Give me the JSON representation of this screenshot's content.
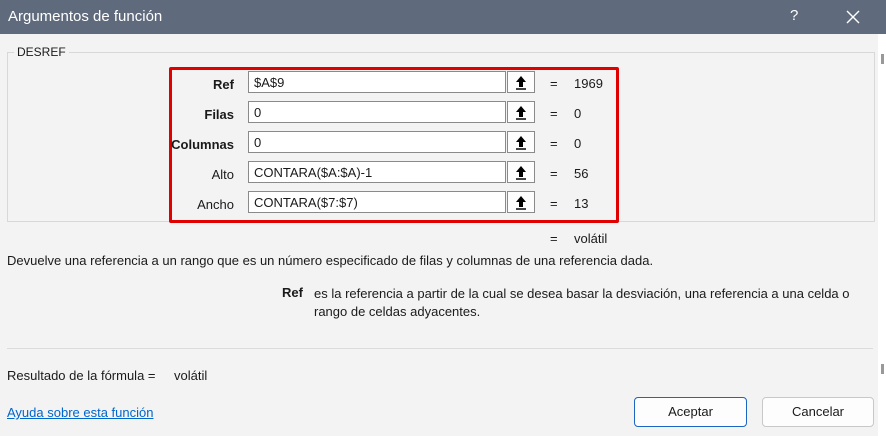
{
  "dialog": {
    "title": "Argumentos de función",
    "help_glyph": "?"
  },
  "group": {
    "label": "DESREF"
  },
  "args": [
    {
      "label": "Ref",
      "value": "$A$9",
      "result": "1969",
      "bold": true
    },
    {
      "label": "Filas",
      "value": "0",
      "result": "0",
      "bold": true
    },
    {
      "label": "Columnas",
      "value": "0",
      "result": "0",
      "bold": true
    },
    {
      "label": "Alto",
      "value": "CONTARA($A:$A)-1",
      "result": "56",
      "bold": false
    },
    {
      "label": "Ancho",
      "value": "CONTARA($7:$7)",
      "result": "13",
      "bold": false
    }
  ],
  "equals": "=",
  "function_result": "volátil",
  "description": "Devuelve una referencia a un rango que es un número especificado de filas y columnas de una referencia dada.",
  "arg_help": {
    "name": "Ref",
    "text": "es la referencia a partir de la cual se desea basar la desviación, una referencia a una celda o rango de celdas adyacentes."
  },
  "formula_result": {
    "label": "Resultado de la fórmula =",
    "value": "volátil"
  },
  "help_link": "Ayuda sobre esta función",
  "buttons": {
    "ok": "Aceptar",
    "cancel": "Cancelar"
  },
  "icons": {
    "collapse": "collapse-dialog-arrow-icon",
    "close": "close-icon"
  },
  "colors": {
    "titlebar": "#5f6a7c",
    "highlight": "#e00000",
    "link": "#0066cc",
    "ok_border": "#1a66c2"
  }
}
